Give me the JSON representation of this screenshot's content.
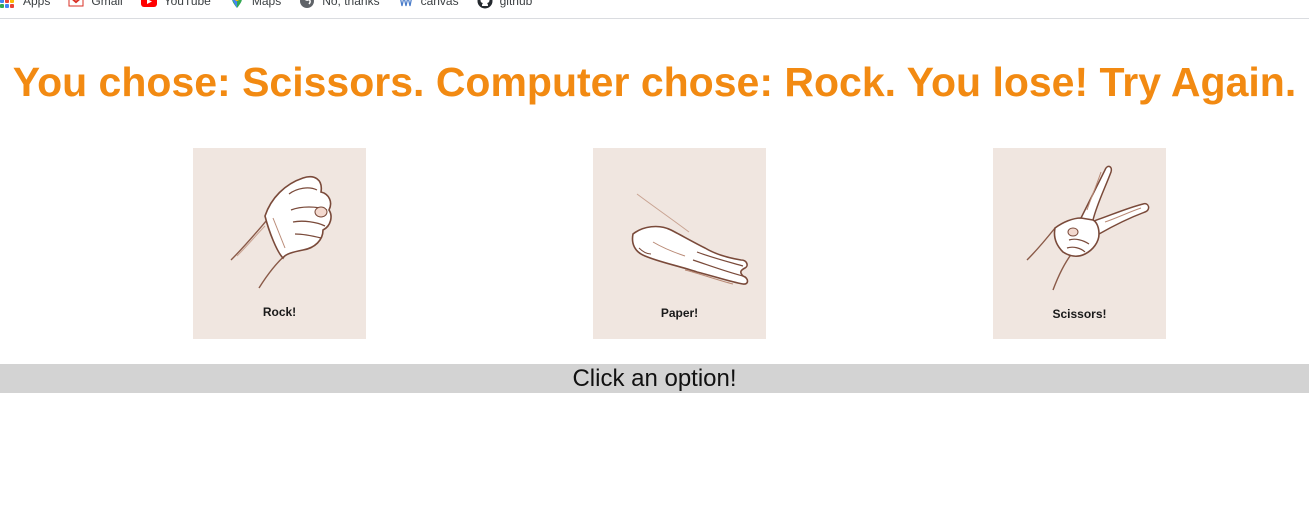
{
  "bookmarks": {
    "items": [
      {
        "label": "Apps"
      },
      {
        "label": "Gmail"
      },
      {
        "label": "YouTube"
      },
      {
        "label": "Maps"
      },
      {
        "label": "No, thanks"
      },
      {
        "label": "canvas"
      },
      {
        "label": "github"
      }
    ]
  },
  "game": {
    "result_text": "You chose: Scissors. Computer chose: Rock. You lose! Try Again.",
    "choices": [
      {
        "label": "Rock!",
        "icon": "rock-hand-icon"
      },
      {
        "label": "Paper!",
        "icon": "paper-hand-icon"
      },
      {
        "label": "Scissors!",
        "icon": "scissors-hand-icon"
      }
    ],
    "prompt": "Click an option!"
  },
  "colors": {
    "heading": "#f28a12",
    "card_background": "#f0e6e0",
    "message_bar": "#d3d3d3"
  }
}
